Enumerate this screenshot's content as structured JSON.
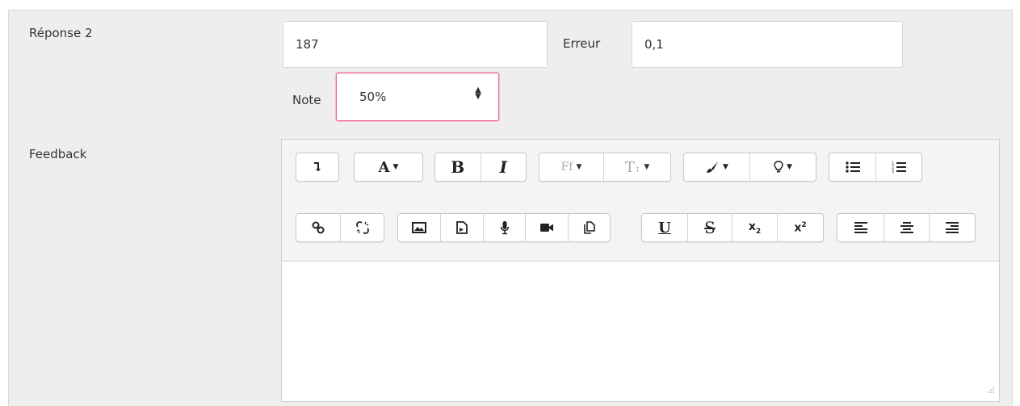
{
  "answer": {
    "label": "Réponse 2",
    "value": "187",
    "error_label": "Erreur",
    "error_value": "0,1"
  },
  "grade": {
    "label": "Note",
    "selected": "50%"
  },
  "feedback": {
    "label": "Feedback",
    "editor": {
      "text": "",
      "toolbar_row1": [
        {
          "name": "collapse-toolbar-icon",
          "glyph": "↴"
        },
        {
          "name": "font-family-icon",
          "glyph": "A"
        },
        {
          "name": "bold-icon",
          "glyph": "B"
        },
        {
          "name": "italic-icon",
          "glyph": "I"
        },
        {
          "name": "font-face-icon",
          "glyph": "Ff"
        },
        {
          "name": "font-size-icon",
          "glyph": "T"
        },
        {
          "name": "text-color-icon",
          "glyph": "brush"
        },
        {
          "name": "background-color-icon",
          "glyph": "bulb"
        },
        {
          "name": "unordered-list-icon",
          "glyph": "ul"
        },
        {
          "name": "ordered-list-icon",
          "glyph": "ol"
        }
      ],
      "toolbar_row2": [
        {
          "name": "link-icon",
          "glyph": "link"
        },
        {
          "name": "unlink-icon",
          "glyph": "unlink"
        },
        {
          "name": "image-icon",
          "glyph": "image"
        },
        {
          "name": "media-icon",
          "glyph": "media"
        },
        {
          "name": "record-audio-icon",
          "glyph": "mic"
        },
        {
          "name": "record-video-icon",
          "glyph": "video"
        },
        {
          "name": "manage-files-icon",
          "glyph": "files"
        },
        {
          "name": "underline-icon",
          "glyph": "U"
        },
        {
          "name": "strikethrough-icon",
          "glyph": "S"
        },
        {
          "name": "subscript-icon",
          "glyph": "x₂"
        },
        {
          "name": "superscript-icon",
          "glyph": "x²"
        },
        {
          "name": "align-left-icon",
          "glyph": "left"
        },
        {
          "name": "align-center-icon",
          "glyph": "center"
        },
        {
          "name": "align-right-icon",
          "glyph": "right"
        }
      ]
    }
  },
  "colors": {
    "panel_bg": "#eeeeee",
    "focus_border": "#f0609d"
  }
}
